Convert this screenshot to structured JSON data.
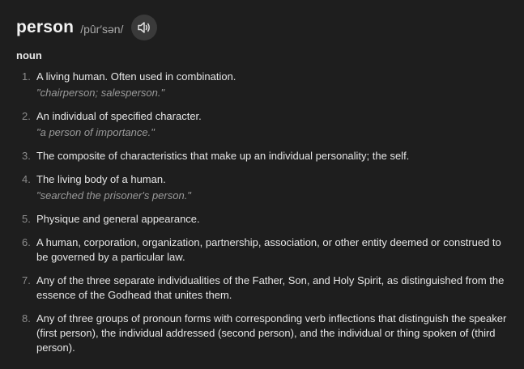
{
  "entry": {
    "headword": "person",
    "pronunciation": "/pûr′sən/",
    "audio_icon": "speaker-icon",
    "part_of_speech": "noun"
  },
  "definitions": [
    {
      "number": "1.",
      "text": "A living human. Often used in combination.",
      "example": "\"chairperson; salesperson.\""
    },
    {
      "number": "2.",
      "text": "An individual of specified character.",
      "example": "\"a person of importance.\""
    },
    {
      "number": "3.",
      "text": "The composite of characteristics that make up an individual personality; the self.",
      "example": ""
    },
    {
      "number": "4.",
      "text": "The living body of a human.",
      "example": "\"searched the prisoner's person.\""
    },
    {
      "number": "5.",
      "text": "Physique and general appearance.",
      "example": ""
    },
    {
      "number": "6.",
      "text": "A human, corporation, organization, partnership, association, or other entity deemed or construed to be governed by a particular law.",
      "example": ""
    },
    {
      "number": "7.",
      "text": "Any of the three separate individualities of the Father, Son, and Holy Spirit, as distinguished from the essence of the Godhead that unites them.",
      "example": ""
    },
    {
      "number": "8.",
      "text": "Any of three groups of pronoun forms with corresponding verb inflections that distinguish the speaker (first person), the individual addressed (second person), and the individual or thing spoken of (third person).",
      "example": ""
    }
  ],
  "colors": {
    "background": "#1e1e1e",
    "text": "#e6e6e6",
    "muted": "#9a9a9a",
    "button": "#3a3a3a"
  }
}
